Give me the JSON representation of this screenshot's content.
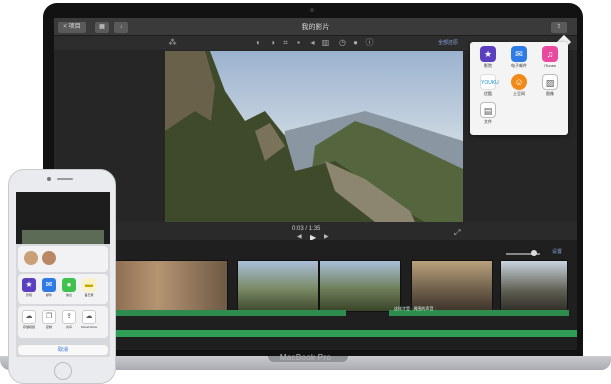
{
  "imovie": {
    "back_label": "< 项目",
    "project_title": "我的影片",
    "reset_all": "全部还原",
    "timecode_current": "0:03",
    "timecode_total": "/ 1:35",
    "settings_label": "设置",
    "audio_clip_label": "这样才是 · 周围的声音 ·"
  },
  "share_menu": {
    "items": [
      {
        "label": "影院",
        "icon": "star-icon",
        "color": "#5a3fc0"
      },
      {
        "label": "电子邮件",
        "icon": "mail-icon",
        "color": "#2f7be5"
      },
      {
        "label": "iTunes",
        "icon": "music-note-icon",
        "color": "#e94aa0"
      },
      {
        "label": "优酷",
        "icon": "youku-icon",
        "color": "#ffffff"
      },
      {
        "label": "土豆网",
        "icon": "tudou-icon",
        "color": "#f28a1a"
      },
      {
        "label": "图像",
        "icon": "image-icon",
        "color": "#ffffff"
      },
      {
        "label": "文件",
        "icon": "file-icon",
        "color": "#ffffff"
      }
    ]
  },
  "laptop": {
    "label": "MacBook Pro"
  },
  "phone": {
    "cancel_label": "取消",
    "share_apps": [
      "影院",
      "邮件",
      "信息",
      "备忘录"
    ],
    "share_actions": [
      "存储视频",
      "复制",
      "共享",
      "iCloud Drive"
    ]
  }
}
